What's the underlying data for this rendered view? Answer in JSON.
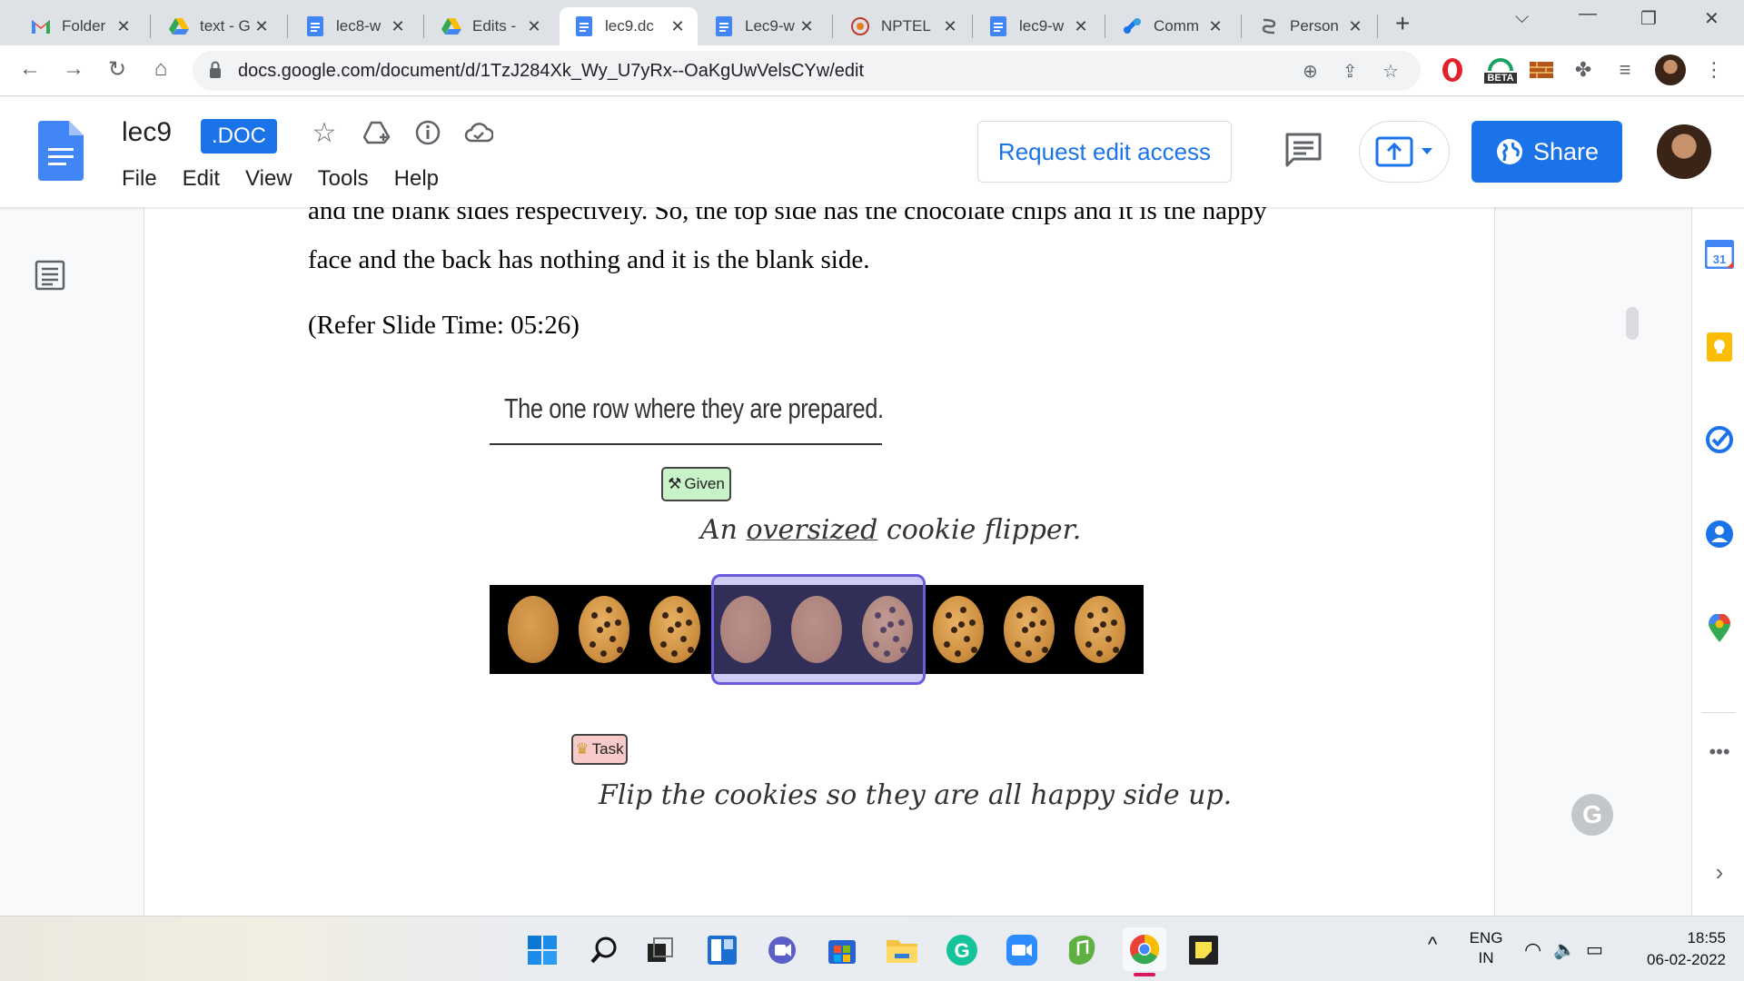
{
  "browser": {
    "tabs": [
      {
        "title": "Folder",
        "icon": "gmail-icon"
      },
      {
        "title": "text - G",
        "icon": "drive-icon"
      },
      {
        "title": "lec8-w",
        "icon": "docs-icon"
      },
      {
        "title": "Edits -",
        "icon": "drive-icon"
      },
      {
        "title": "lec9.dc",
        "icon": "docs-icon",
        "active": true
      },
      {
        "title": "Lec9-w",
        "icon": "docs-icon"
      },
      {
        "title": "NPTEL",
        "icon": "nptel-icon"
      },
      {
        "title": "lec9-w",
        "icon": "docs-icon"
      },
      {
        "title": "Comm",
        "icon": "link-icon"
      },
      {
        "title": "Person",
        "icon": "person-link-icon"
      }
    ],
    "url": "docs.google.com/document/d/1TzJ284Xk_Wy_U7yRx--OaKgUwVelsCYw/edit",
    "ext_badge": "BETA"
  },
  "doc": {
    "title": "lec9",
    "badge": ".DOC",
    "menu": [
      "File",
      "Edit",
      "View",
      "Tools",
      "Help"
    ],
    "request_edit": "Request edit access",
    "share": "Share"
  },
  "page": {
    "line1": "and the blank sides respectively. So, the top side has the chocolate chips and it is the happy",
    "line2": "face and the back has nothing and it is the blank side.",
    "line3": "(Refer Slide Time: 05:26)"
  },
  "slide": {
    "heading": "The one row where they are prepared.",
    "given_tag": "Given",
    "given_pre": "An ",
    "given_under": "oversized",
    "given_post": " cookie flipper.",
    "task_tag": "Task",
    "task_text": "Flip the cookies so they are all happy side up.",
    "cookies": [
      "blank",
      "happy",
      "happy",
      "blank",
      "blank",
      "happy",
      "happy",
      "happy",
      "happy"
    ],
    "flipper_start": 3,
    "flipper_size": 3
  },
  "taskbar": {
    "lang1": "ENG",
    "lang2": "IN",
    "time": "18:55",
    "date": "06-02-2022"
  },
  "colors": {
    "accent": "#1a73e8",
    "selection": "#6a5adf"
  }
}
